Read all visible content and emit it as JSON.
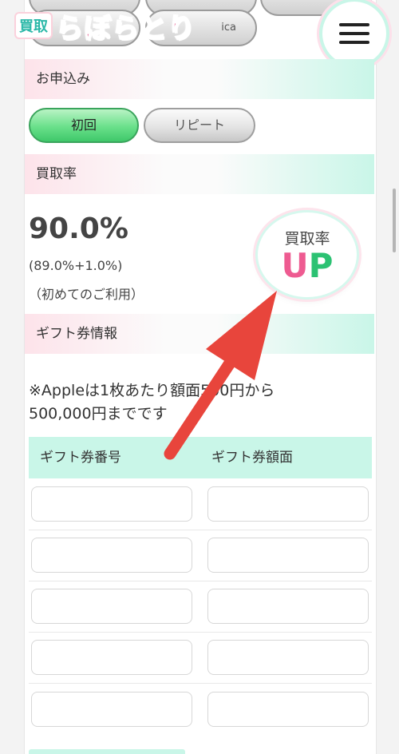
{
  "header": {
    "logo_prefix": "買取",
    "logo_main": "らぼらとり",
    "menu_icon": "hamburger-menu-icon",
    "top_pills": [
      "",
      "",
      "",
      "ica"
    ]
  },
  "application": {
    "section_title": "お申込み",
    "tabs": [
      {
        "label": "初回",
        "selected": true
      },
      {
        "label": "リピート",
        "selected": false
      }
    ]
  },
  "rate": {
    "section_title": "買取率",
    "value": "90.0%",
    "breakdown": "(89.0%+1.0%)",
    "note": "（初めてのご利用）",
    "badge_label": "買取率",
    "badge_up_u": "U",
    "badge_up_p": "P"
  },
  "gift": {
    "section_title": "ギフト券情報",
    "notice_line1": "※Appleは1枚あたり額面500円から",
    "notice_line2": "500,000円までです",
    "columns": [
      "ギフト券番号",
      "ギフト券額面"
    ],
    "rows": [
      {
        "number": "",
        "amount": ""
      },
      {
        "number": "",
        "amount": ""
      },
      {
        "number": "",
        "amount": ""
      },
      {
        "number": "",
        "amount": ""
      },
      {
        "number": "",
        "amount": ""
      }
    ]
  },
  "colors": {
    "mint": "#c9f6e8",
    "pink": "#fde3ea",
    "arrow": "#e8453c",
    "up_u": "#ee5b91",
    "up_p": "#2cc273",
    "tab_active": "#69e08a"
  }
}
